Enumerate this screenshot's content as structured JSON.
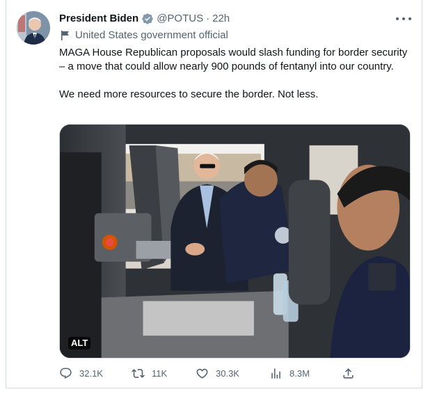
{
  "author": {
    "name": "President Biden",
    "handle": "@POTUS",
    "time": "22h",
    "separator": "·",
    "label": "United States government official"
  },
  "tweet": {
    "paragraph1": "MAGA House Republican proposals would slash funding for border security – a move that could allow nearly 900 pounds of fentanyl into our country.",
    "paragraph2": "We need more resources to secure the border. Not less."
  },
  "media": {
    "alt_badge": "ALT"
  },
  "actions": {
    "replies": "32.1K",
    "retweets": "11K",
    "likes": "30.3K",
    "views": "8.3M"
  },
  "colors": {
    "verified_badge": "#829aab",
    "secondary_text": "#536471",
    "border": "#cfd9de"
  },
  "icons": {
    "reply": "reply-icon",
    "retweet": "retweet-icon",
    "like": "heart-icon",
    "views": "views-icon",
    "share": "share-icon",
    "more": "more-icon",
    "label": "flag-icon",
    "verified": "verified-badge-icon"
  }
}
